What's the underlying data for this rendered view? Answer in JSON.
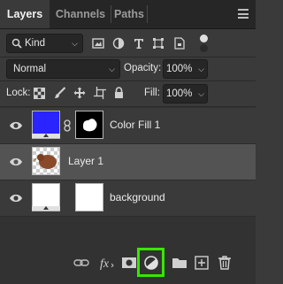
{
  "tabs": [
    {
      "label": "Layers",
      "active": true
    },
    {
      "label": "Channels",
      "active": false
    },
    {
      "label": "Paths",
      "active": false
    }
  ],
  "panel_menu_icon": "hamburger-menu-icon",
  "filter": {
    "kind_label": "Kind",
    "icons": [
      "pixel-filter-icon",
      "adjustment-filter-icon",
      "type-filter-icon",
      "shape-filter-icon",
      "smart-object-filter-icon",
      "filter-toggle-icon"
    ]
  },
  "blend": {
    "mode": "Normal",
    "opacity_label": "Opacity:",
    "opacity_value": "100%"
  },
  "lock": {
    "label": "Lock:",
    "icons": [
      "lock-transparent-pixels-icon",
      "lock-image-pixels-icon",
      "lock-position-icon",
      "lock-artboard-icon",
      "lock-all-icon"
    ],
    "fill_label": "Fill:",
    "fill_value": "100%"
  },
  "layers": [
    {
      "name": "Color Fill 1",
      "selected": false,
      "thumb_color": "#2a24ff",
      "has_mask": true
    },
    {
      "name": "Layer 1",
      "selected": true,
      "thumb_color": "#8a4a2a",
      "has_mask": false
    },
    {
      "name": "background",
      "selected": false,
      "thumb_color": "#ffffff",
      "has_mask": true
    }
  ],
  "footer_icons": [
    "link-layers-icon",
    "fx-icon",
    "add-mask-icon",
    "adjustment-layer-icon",
    "group-folder-icon",
    "new-layer-icon",
    "trash-icon"
  ],
  "colors": {
    "highlight": "#39e600",
    "selected_row": "#535353"
  }
}
